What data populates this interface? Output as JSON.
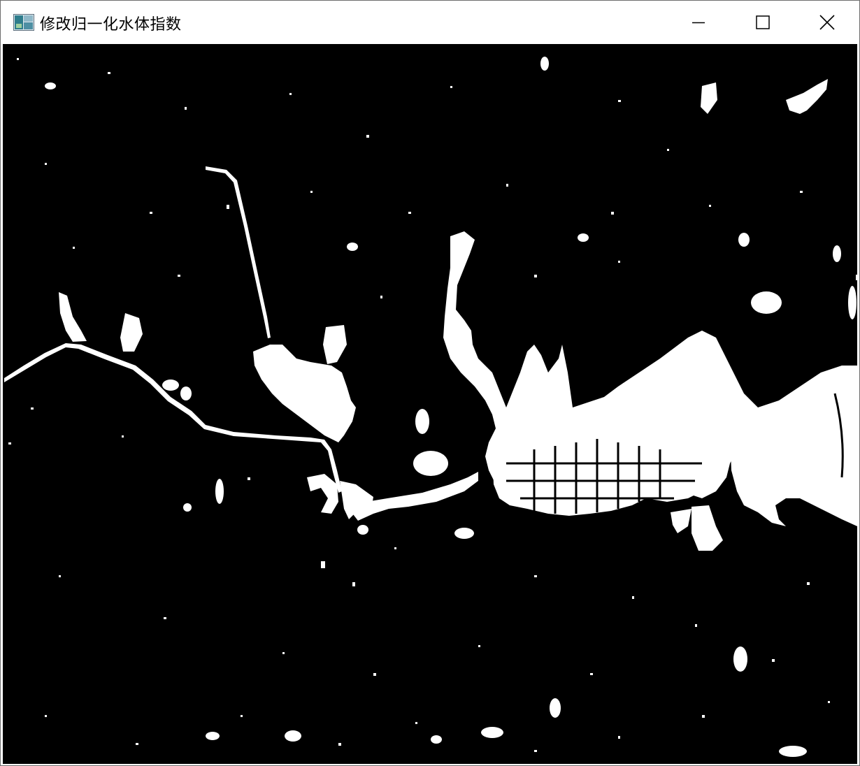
{
  "window": {
    "title": "修改归一化水体指数",
    "controls": {
      "minimize": "minimize-icon",
      "maximize": "maximize-icon",
      "close": "close-icon"
    }
  },
  "image": {
    "kind": "binary water-index mask",
    "background_color": "#000000",
    "water_color": "#ffffff"
  }
}
